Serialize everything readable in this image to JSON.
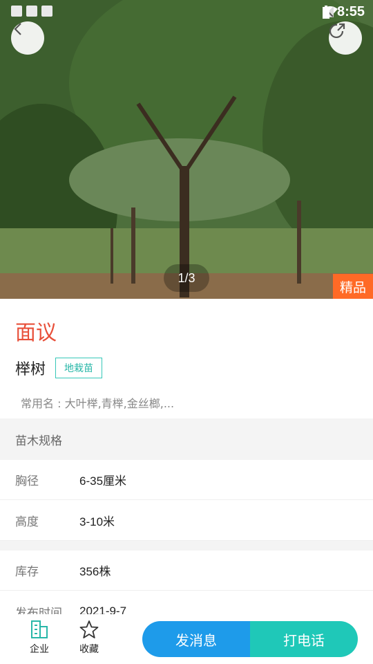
{
  "status_bar": {
    "time": "8:55"
  },
  "gallery": {
    "pager": "1/3",
    "badge": "精品"
  },
  "product": {
    "price": "面议",
    "name": "榉树",
    "tag": "地栽苗",
    "common_name": "常用名 : 大叶榉,青榉,金丝榔,..."
  },
  "specs": {
    "section_title": "苗木规格",
    "rows": [
      {
        "label": "胸径",
        "value": "6-35厘米"
      },
      {
        "label": "高度",
        "value": "3-10米"
      }
    ]
  },
  "info": {
    "rows": [
      {
        "label": "库存",
        "value": "356株"
      },
      {
        "label": "发布时间",
        "value": "2021-9-7"
      }
    ]
  },
  "bottom_bar": {
    "company_label": "企业",
    "favorite_label": "收藏",
    "message_button": "发消息",
    "call_button": "打电话"
  },
  "colors": {
    "price": "#e8503a",
    "tag": "#28b7a8",
    "message_button": "#1e9bea",
    "call_button": "#1fc8b8",
    "premium_badge": "#ff6a26"
  },
  "icons": [
    "back-arrow-icon",
    "share-icon",
    "company-icon",
    "star-icon",
    "wifi-icon",
    "signal-icon",
    "battery-icon"
  ]
}
